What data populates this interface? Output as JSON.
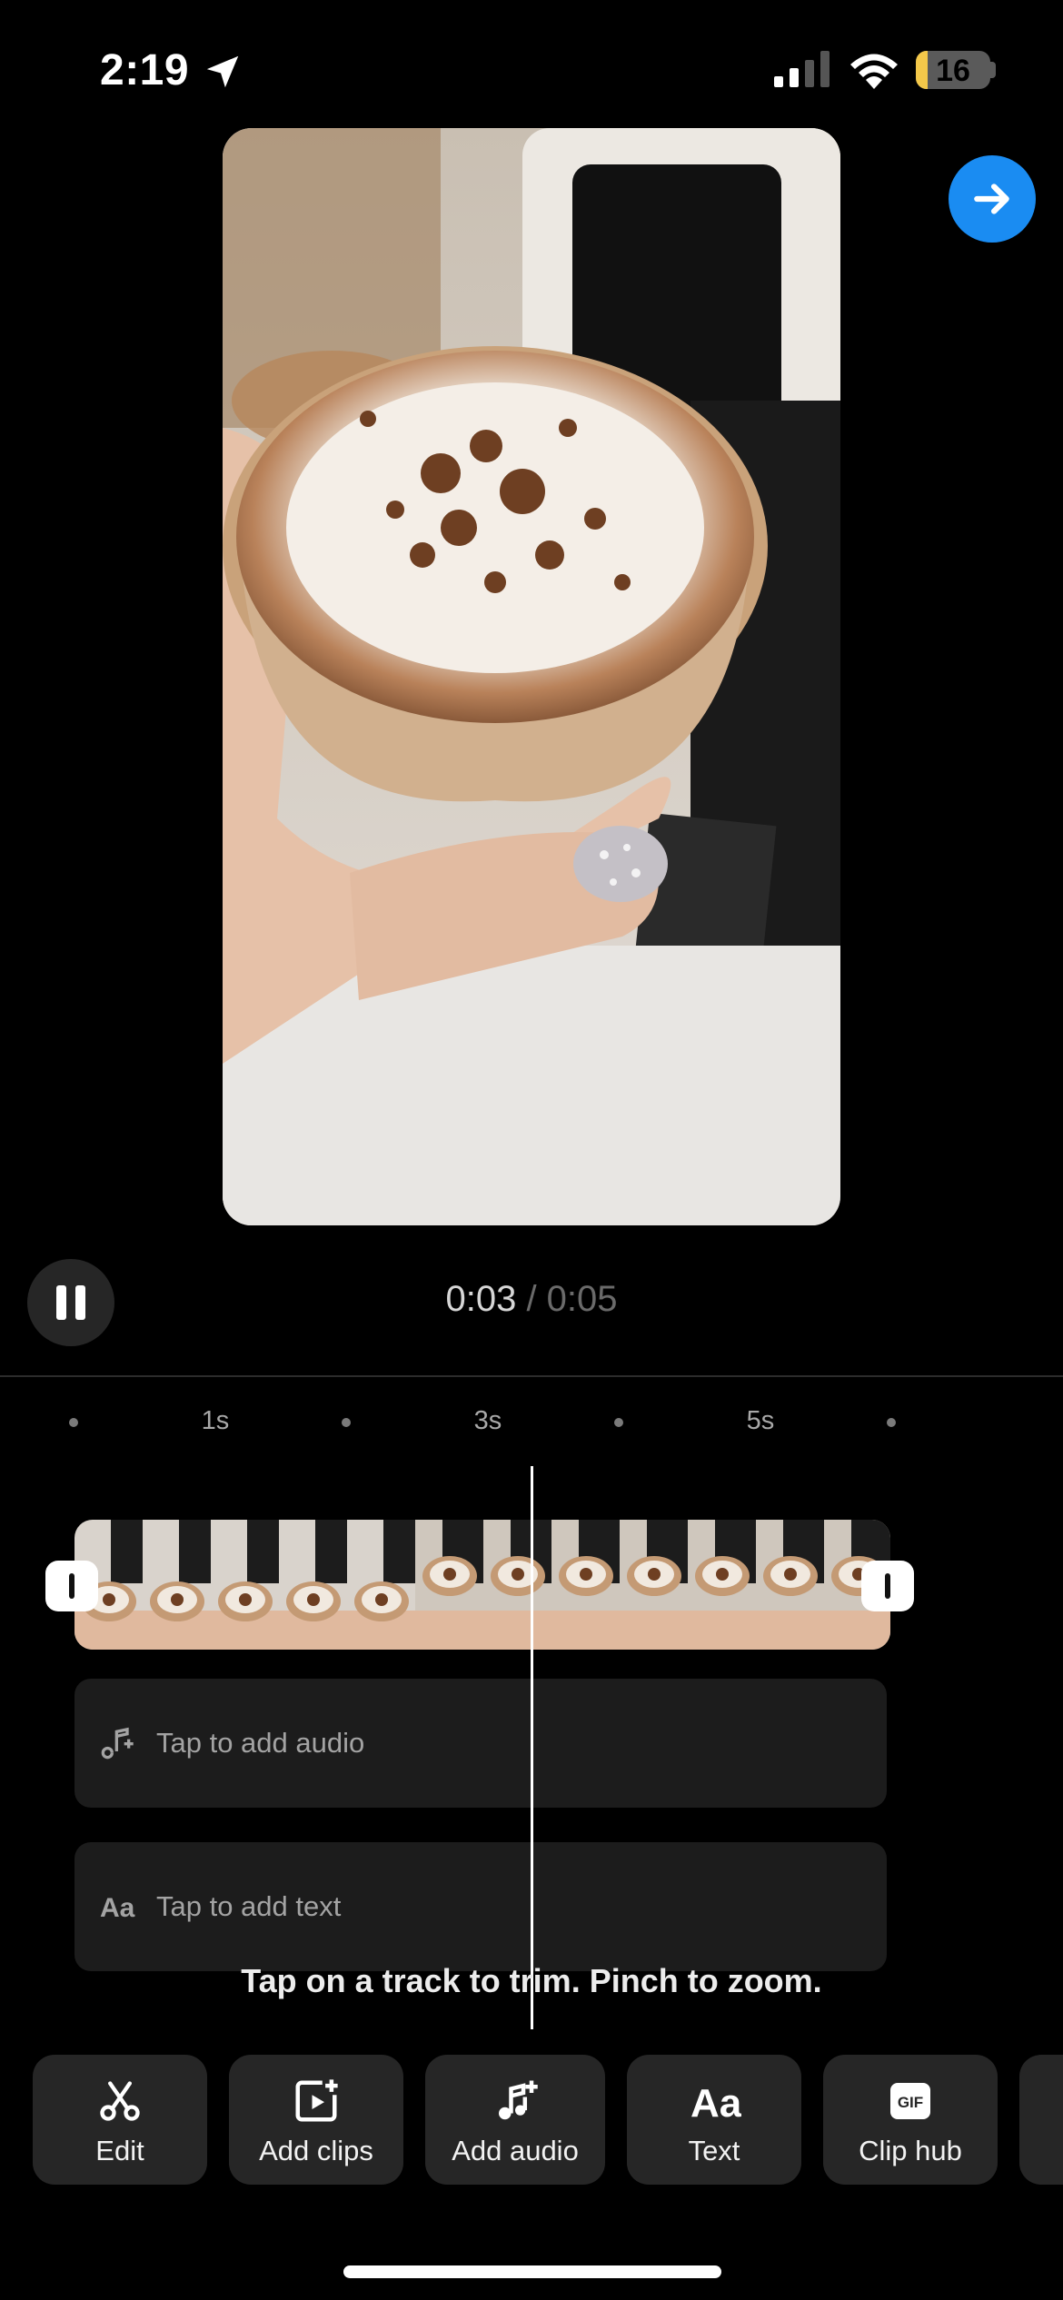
{
  "status_bar": {
    "time": "2:19",
    "battery": "16",
    "icons": [
      "location-arrow-icon",
      "signal-icon",
      "wifi-icon",
      "battery-icon"
    ]
  },
  "header": {
    "next_icon": "arrow-right-icon",
    "accent": "#1a8cf2"
  },
  "playback": {
    "current": "0:03",
    "separator": " / ",
    "total": "0:05",
    "state_icon": "pause-icon",
    "progress": 0.6
  },
  "ruler": {
    "labels": [
      "1s",
      "3s",
      "5s"
    ]
  },
  "tracks": {
    "audio_placeholder": "Tap to add audio",
    "text_placeholder": "Tap to add text"
  },
  "hint": "Tap on a track to trim. Pinch to zoom.",
  "toolbar": {
    "items": [
      {
        "label": "Edit",
        "icon": "scissors-icon"
      },
      {
        "label": "Add clips",
        "icon": "add-clip-icon"
      },
      {
        "label": "Add audio",
        "icon": "add-music-icon"
      },
      {
        "label": "Text",
        "icon": "text-aa-icon"
      },
      {
        "label": "Clip hub",
        "icon": "gif-icon",
        "icon_text": "GIF"
      }
    ]
  }
}
